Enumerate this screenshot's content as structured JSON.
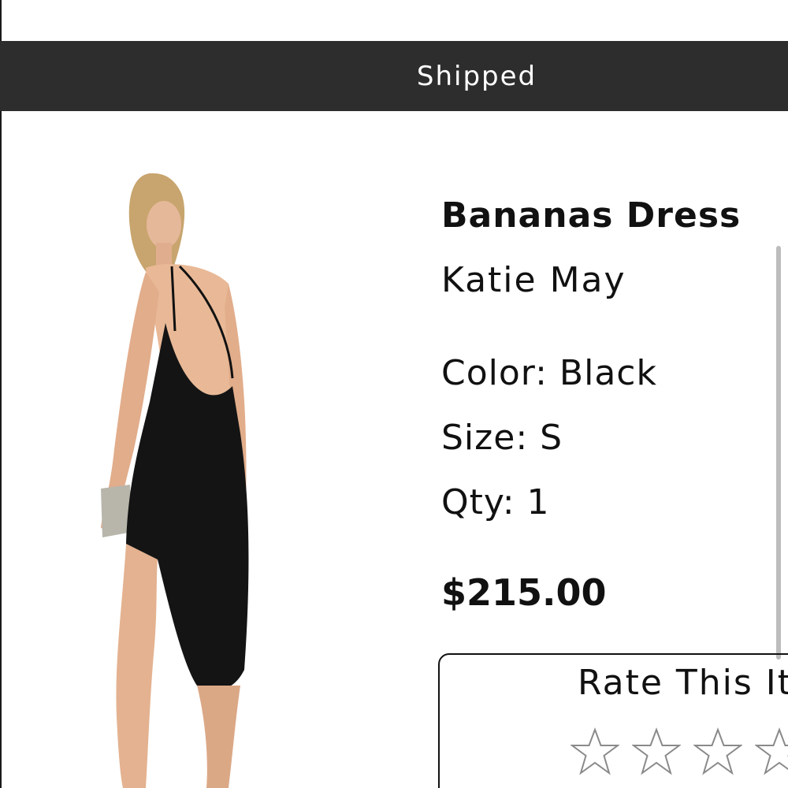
{
  "order": {
    "status": "Shipped"
  },
  "product": {
    "name": "Bananas Dress",
    "brand": "Katie May",
    "color_line": "Color: Black",
    "size_line": "Size: S",
    "qty_line": "Qty: 1",
    "price": "$215.00"
  },
  "rating": {
    "title": "Rate This Item",
    "star_icon": "star-outline-icon",
    "current_rating": 0,
    "max_rating": 5
  },
  "colors": {
    "status_bar": "#2d2d2d",
    "text": "#111111",
    "star_outline": "#8a8a8a"
  }
}
